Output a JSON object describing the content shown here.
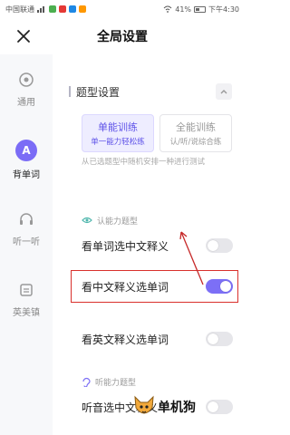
{
  "status_bar": {
    "carrier": "中国联通",
    "battery": "41%",
    "time": "下午4:30"
  },
  "header": {
    "title": "全局设置",
    "close_icon": "close-icon"
  },
  "sidebar": {
    "items": [
      {
        "label": "通用",
        "icon": "settings-circle-icon",
        "active": false
      },
      {
        "label": "背单词",
        "icon": "avatar-a-icon",
        "avatar_letter": "A",
        "active": true
      },
      {
        "label": "听一听",
        "icon": "headphones-icon",
        "active": false
      },
      {
        "label": "英美镇",
        "icon": "book-icon",
        "active": false
      }
    ]
  },
  "main": {
    "section_title": "题型设置",
    "modes": [
      {
        "title": "单能训练",
        "subtitle": "单一能力轻松练",
        "selected": true
      },
      {
        "title": "全能训练",
        "subtitle": "认/听/说综合练",
        "selected": false
      }
    ],
    "description": "从已选题型中随机安排一种进行测试",
    "groups": [
      {
        "label": "认能力题型",
        "icon": "eye-icon",
        "options": [
          {
            "label": "看单词选中文释义",
            "enabled": false
          },
          {
            "label": "看中文释义选单词",
            "enabled": true
          },
          {
            "label": "看英文释义选单词",
            "enabled": false
          }
        ]
      },
      {
        "label": "听能力题型",
        "icon": "ear-icon",
        "options": [
          {
            "label": "听音选中文释义",
            "enabled": false
          }
        ]
      }
    ]
  },
  "watermark": {
    "text": "单机狗",
    "icon": "dog-logo-icon"
  },
  "colors": {
    "accent": "#7c6ff6",
    "highlight_box": "#d9302c",
    "sidebar_bg": "#f7f8fa"
  }
}
